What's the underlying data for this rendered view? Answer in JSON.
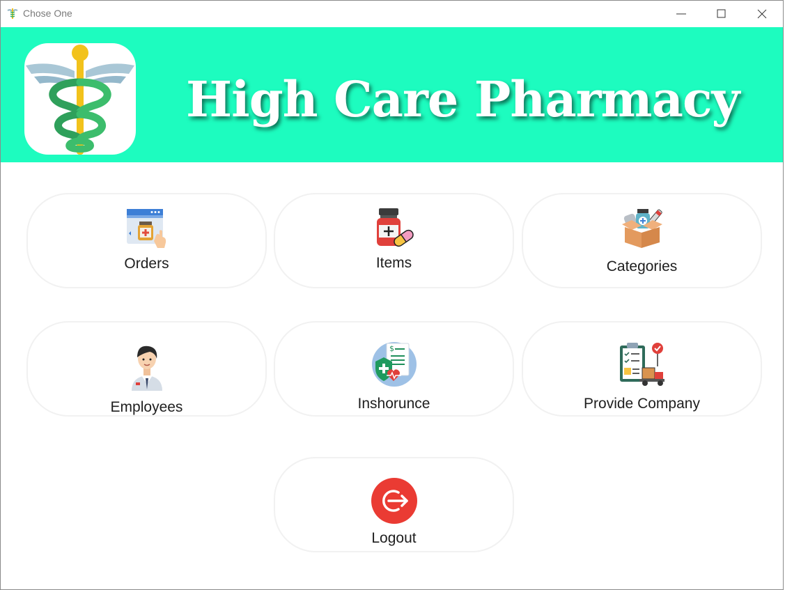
{
  "window": {
    "title": "Chose One"
  },
  "banner": {
    "title": "High Care Pharmacy",
    "background": "#1dfcbf"
  },
  "menu": {
    "orders": "Orders",
    "items": "Items",
    "categories": "Categories",
    "employees": "Employees",
    "insurance": "Inshorunce",
    "provide_company": "Provide Company",
    "logout": "Logout"
  },
  "icons": {
    "orders": "pharmacy-web-order-icon",
    "items": "medicine-bottle-pill-icon",
    "categories": "medical-supplies-box-icon",
    "employees": "doctor-avatar-icon",
    "insurance": "health-insurance-icon",
    "provide_company": "clipboard-delivery-icon",
    "logout": "logout-icon"
  }
}
